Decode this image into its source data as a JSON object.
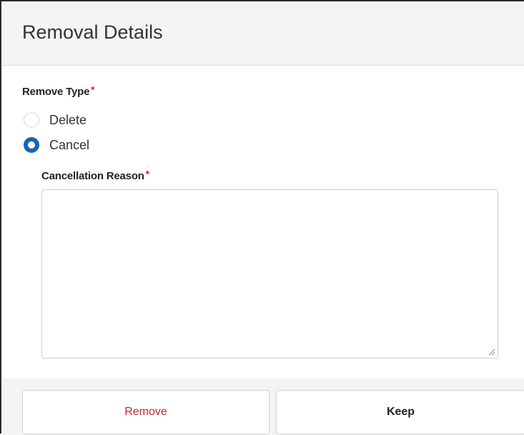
{
  "dialog": {
    "title": "Removal Details"
  },
  "remove_type": {
    "label": "Remove Type",
    "required_mark": "*",
    "options": [
      {
        "label": "Delete",
        "checked": false
      },
      {
        "label": "Cancel",
        "checked": true
      }
    ]
  },
  "cancellation_reason": {
    "label": "Cancellation Reason",
    "required_mark": "*",
    "value": ""
  },
  "footer": {
    "remove_label": "Remove",
    "keep_label": "Keep"
  },
  "colors": {
    "accent": "#1565b2",
    "danger": "#c62828",
    "required": "#c8102e",
    "header_bg": "#f4f4f4"
  }
}
